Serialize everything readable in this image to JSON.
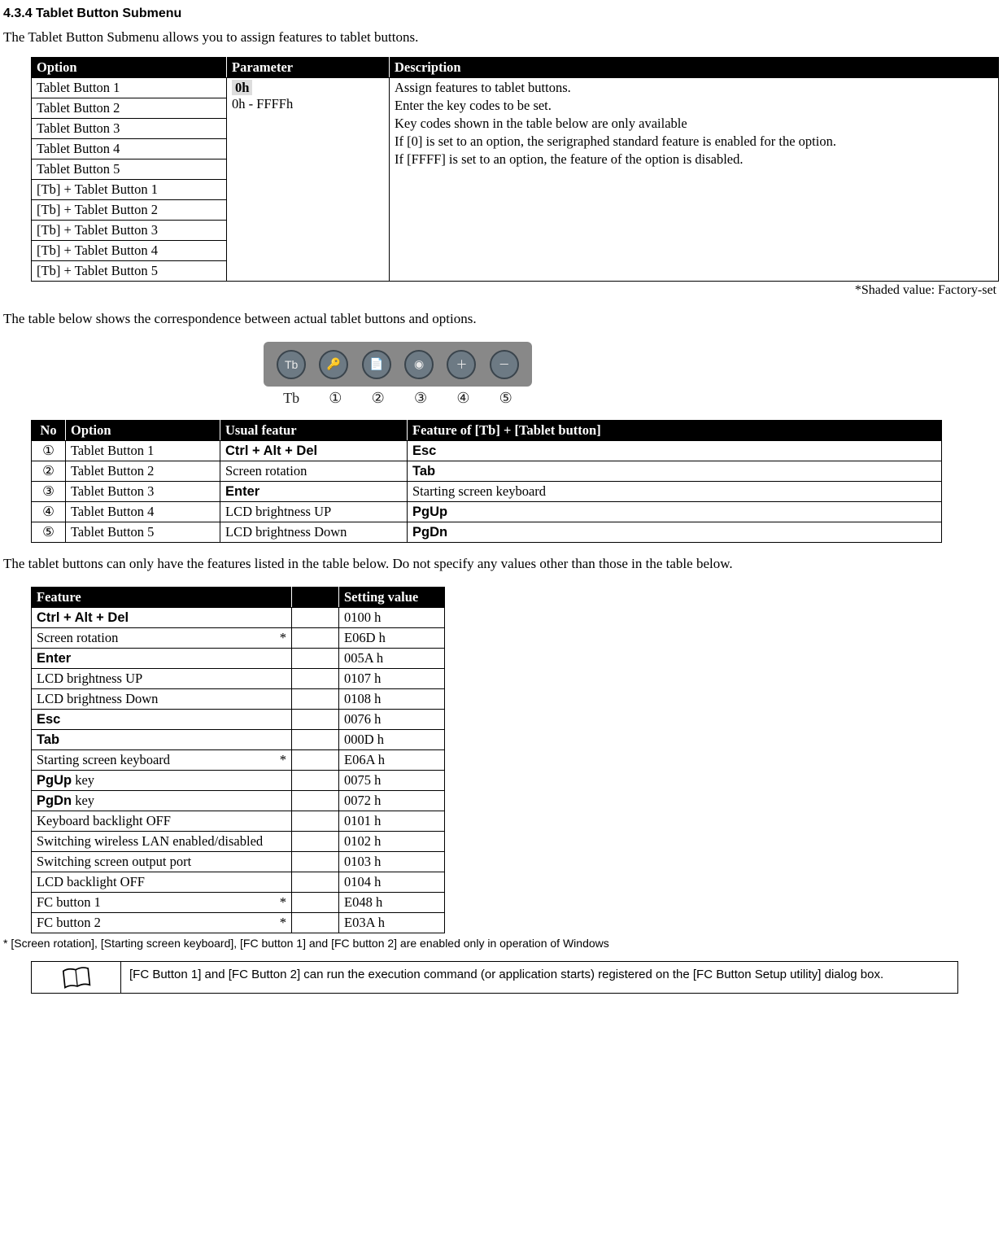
{
  "heading": "4.3.4  Tablet Button Submenu",
  "intro": "The Tablet Button Submenu allows you to assign features to tablet buttons.",
  "table1": {
    "headers": [
      "Option",
      "Parameter",
      "Description"
    ],
    "options": [
      "Tablet Button 1",
      "Tablet Button 2",
      "Tablet Button 3",
      "Tablet Button 4",
      "Tablet Button 5",
      "[Tb] + Tablet Button 1",
      "[Tb] + Tablet Button 2",
      "[Tb] + Tablet Button 3",
      "[Tb] + Tablet Button 4",
      "[Tb] + Tablet Button 5"
    ],
    "param_default": "0h",
    "param_range": "0h - FFFFh",
    "desc": {
      "l1": "Assign features to tablet buttons.",
      "l2": "Enter the key codes to be set.",
      "l3": "Key codes shown in the table below are only available",
      "l4": "If [0] is set to an option, the serigraphed standard feature is enabled for the option.",
      "l5": "If [FFFF] is set to an option, the feature of the option is disabled."
    }
  },
  "shaded_note": "*Shaded value: Factory-set",
  "para2": "The table below shows the correspondence between actual tablet buttons and options.",
  "btn_labels": [
    "Tb",
    "①",
    "②",
    "③",
    "④",
    "⑤"
  ],
  "btn_glyphs": [
    "Tb",
    "🔑",
    "📄",
    "◉",
    "＋",
    "－"
  ],
  "table2": {
    "headers": [
      "No",
      "Option",
      "Usual featur",
      "Feature of [Tb] + [Tablet button]"
    ],
    "rows": [
      {
        "no": "①",
        "opt": "Tablet Button 1",
        "usual_bold": "Ctrl + Alt + Del",
        "usual_plain": "",
        "tb_bold": "Esc",
        "tb_plain": ""
      },
      {
        "no": "②",
        "opt": "Tablet Button 2",
        "usual_bold": "",
        "usual_plain": "Screen rotation",
        "tb_bold": "Tab",
        "tb_plain": ""
      },
      {
        "no": "③",
        "opt": "Tablet Button 3",
        "usual_bold": "Enter",
        "usual_plain": "",
        "tb_bold": "",
        "tb_plain": "Starting screen keyboard"
      },
      {
        "no": "④",
        "opt": "Tablet Button 4",
        "usual_bold": "",
        "usual_plain": "LCD brightness UP",
        "tb_bold": "PgUp",
        "tb_plain": ""
      },
      {
        "no": "⑤",
        "opt": "Tablet Button 5",
        "usual_bold": "",
        "usual_plain": "LCD brightness Down",
        "tb_bold": "PgDn",
        "tb_plain": ""
      }
    ]
  },
  "para3": "The tablet buttons can only have the features listed in the table below. Do not specify any values other than those in the table below.",
  "table3": {
    "headers": [
      "Feature",
      "",
      "Setting value"
    ],
    "rows": [
      {
        "f_bold": "Ctrl + Alt + Del",
        "f_plain": "",
        "star": "",
        "val": "0100 h"
      },
      {
        "f_bold": "",
        "f_plain": "Screen rotation",
        "star": "*",
        "val": "E06D h"
      },
      {
        "f_bold": "Enter",
        "f_plain": "",
        "star": "",
        "val": "005A h"
      },
      {
        "f_bold": "",
        "f_plain": "LCD brightness UP",
        "star": "",
        "val": "0107 h"
      },
      {
        "f_bold": "",
        "f_plain": "LCD brightness Down",
        "star": "",
        "val": "0108 h"
      },
      {
        "f_bold": "Esc",
        "f_plain": "",
        "star": "",
        "val": "0076 h"
      },
      {
        "f_bold": "Tab",
        "f_plain": "",
        "star": "",
        "val": "000D h"
      },
      {
        "f_bold": "",
        "f_plain": "Starting screen keyboard",
        "star": "*",
        "val": "E06A h"
      },
      {
        "f_bold": "PgUp",
        "f_plain": " key",
        "star": "",
        "val": "0075 h"
      },
      {
        "f_bold": "PgDn",
        "f_plain": " key",
        "star": "",
        "val": "0072 h"
      },
      {
        "f_bold": "",
        "f_plain": "Keyboard backlight OFF",
        "star": "",
        "val": "0101 h"
      },
      {
        "f_bold": "",
        "f_plain": "Switching wireless LAN enabled/disabled",
        "star": "",
        "val": "0102 h"
      },
      {
        "f_bold": "",
        "f_plain": "Switching screen output port",
        "star": "",
        "val": "0103 h"
      },
      {
        "f_bold": "",
        "f_plain": "LCD backlight OFF",
        "star": "",
        "val": "0104 h"
      },
      {
        "f_bold": "",
        "f_plain": "FC button 1",
        "star": "*",
        "val": "E048 h"
      },
      {
        "f_bold": "",
        "f_plain": "FC button 2",
        "star": "*",
        "val": "E03A h"
      }
    ]
  },
  "star_note": "* [Screen rotation], [Starting screen keyboard], [FC button 1] and [FC button 2] are enabled only in operation of Windows",
  "notebox": "[FC Button 1] and [FC Button 2] can run the execution command (or application starts) registered on the [FC Button Setup utility] dialog box."
}
